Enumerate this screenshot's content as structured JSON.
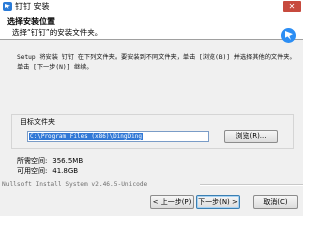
{
  "window": {
    "title": "钉钉 安装",
    "close_label": "✕"
  },
  "header": {
    "title": "选择安装位置",
    "subtitle": "选择“钉钉”的安装文件夹。"
  },
  "description": "Setup 将安装 钉钉 在下列文件夹。要安装到不同文件夹，单击 [浏览(B)] 并选择其他的文件夹。 单击 [下一步(N)] 继续。",
  "target": {
    "group_label": "目标文件夹",
    "path": "C:\\Program Files (x86)\\DingDing",
    "browse_label": "浏览(R)..."
  },
  "space": {
    "required_label": "所需空间:",
    "required_value": "356.5MB",
    "available_label": "可用空间:",
    "available_value": "41.8GB"
  },
  "footer": {
    "branding": "Nullsoft Install System v2.46.5-Unicode",
    "back_label": "< 上一步(P)",
    "next_label": "下一步(N) >",
    "cancel_label": "取消(C)"
  }
}
